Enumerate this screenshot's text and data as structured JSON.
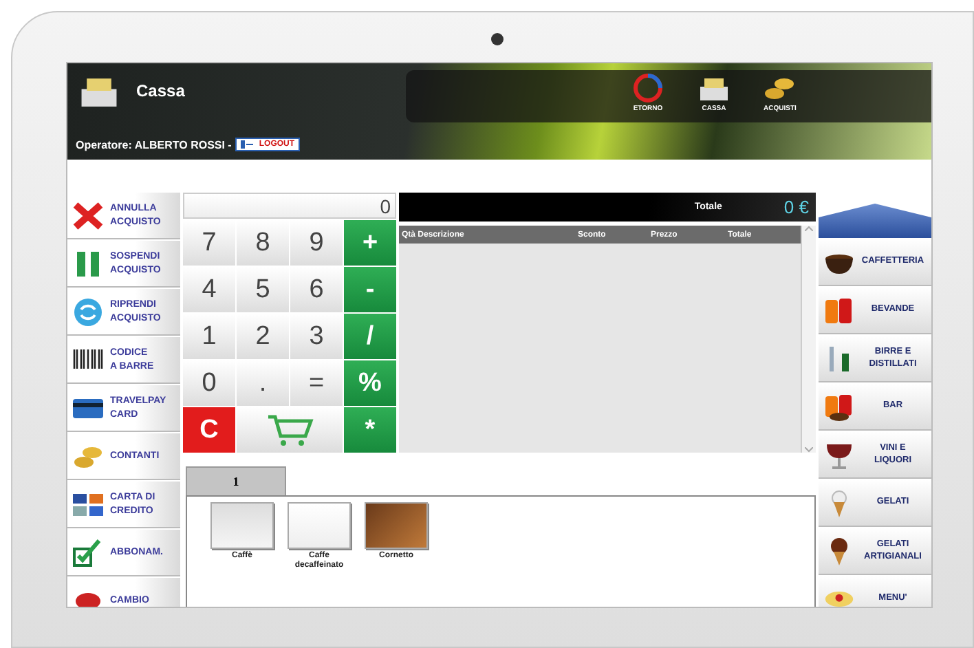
{
  "header": {
    "title": "Cassa",
    "operator": "Operatore: ALBERTO ROSSI -",
    "logout": "LOGOUT",
    "nav": [
      {
        "label": "ETORNO"
      },
      {
        "label": "CASSA"
      },
      {
        "label": "ACQUISTI"
      }
    ]
  },
  "left_actions": [
    {
      "label": "ANNULLA\nACQUISTO"
    },
    {
      "label": "SOSPENDI\nACQUISTO"
    },
    {
      "label": "RIPRENDI\nACQUISTO"
    },
    {
      "label": "CODICE\nA BARRE"
    },
    {
      "label": "TRAVELPAY\nCARD"
    },
    {
      "label": "CONTANTI"
    },
    {
      "label": "CARTA DI\nCREDITO"
    },
    {
      "label": "ABBONAM."
    },
    {
      "label": "CAMBIO"
    }
  ],
  "keypad": {
    "display": "0",
    "keys": [
      {
        "kind": "digit",
        "label": "7"
      },
      {
        "kind": "digit",
        "label": "8"
      },
      {
        "kind": "digit",
        "label": "9"
      },
      {
        "kind": "op",
        "label": "+"
      },
      {
        "kind": "digit",
        "label": "4"
      },
      {
        "kind": "digit",
        "label": "5"
      },
      {
        "kind": "digit",
        "label": "6"
      },
      {
        "kind": "op",
        "label": "-"
      },
      {
        "kind": "digit",
        "label": "1"
      },
      {
        "kind": "digit",
        "label": "2"
      },
      {
        "kind": "digit",
        "label": "3"
      },
      {
        "kind": "op",
        "label": "/"
      },
      {
        "kind": "digit",
        "label": "0"
      },
      {
        "kind": "digit",
        "label": "."
      },
      {
        "kind": "digit",
        "label": "="
      },
      {
        "kind": "op",
        "label": "%"
      },
      {
        "kind": "clear",
        "label": "C"
      },
      {
        "kind": "cart"
      },
      {
        "kind": "op",
        "label": "*"
      }
    ]
  },
  "receipt": {
    "total_label": "Totale",
    "total_amount": "0 €",
    "columns": [
      "Qtà Descrizione",
      "Sconto",
      "Prezzo",
      "Totale"
    ]
  },
  "categories": [
    {
      "label": "CAFFETTERIA"
    },
    {
      "label": "BEVANDE"
    },
    {
      "label": "BIRRE E\nDISTILLATI"
    },
    {
      "label": "BAR"
    },
    {
      "label": "VINI E\nLIQUORI"
    },
    {
      "label": "GELATI"
    },
    {
      "label": "GELATI\nARTIGIANALI"
    },
    {
      "label": "MENU'"
    }
  ],
  "product_tabs": [
    {
      "label": "1",
      "selected": true
    }
  ],
  "products": [
    {
      "name": "Caffè"
    },
    {
      "name": "Caffe\ndecaffeinato"
    },
    {
      "name": "Cornetto"
    }
  ]
}
